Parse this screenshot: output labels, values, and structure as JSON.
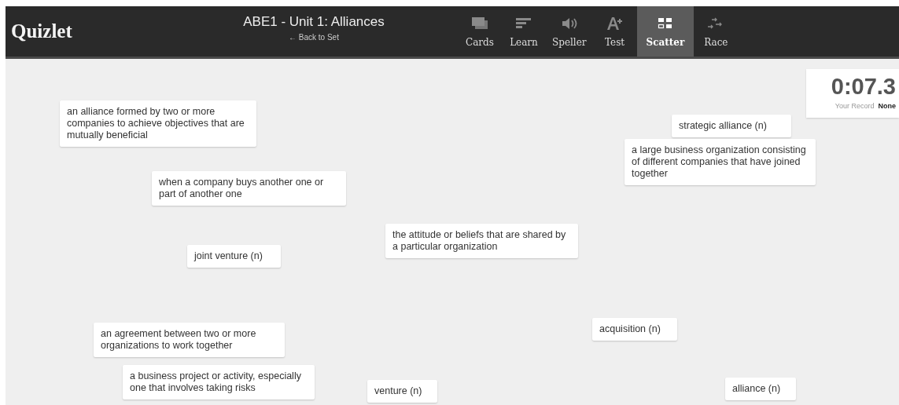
{
  "header": {
    "logo": "Quizlet",
    "title": "ABE1 - Unit 1: Alliances",
    "back_link": "← Back to Set"
  },
  "modes": [
    {
      "label": "Cards",
      "kind": "cards",
      "selected": false
    },
    {
      "label": "Learn",
      "kind": "learn",
      "selected": false
    },
    {
      "label": "Speller",
      "kind": "speller",
      "selected": false
    },
    {
      "label": "Test",
      "kind": "test",
      "selected": false
    },
    {
      "label": "Scatter",
      "kind": "scatter",
      "selected": true
    },
    {
      "label": "Race",
      "kind": "race",
      "selected": false
    }
  ],
  "timer": {
    "time": "0:07.3",
    "record_label": "Your Record",
    "record_value": "None"
  },
  "cards": [
    {
      "text": "an alliance formed by two or more companies to achieve objectives that are mutually beneficial"
    },
    {
      "text": "when a company buys another one or part of another one"
    },
    {
      "text": "joint venture (n)"
    },
    {
      "text": "the attitude or beliefs that are shared by a particular organization"
    },
    {
      "text": "strategic alliance (n)"
    },
    {
      "text": "a large business organization consisting of different companies that have joined together"
    },
    {
      "text": "an agreement between two or more organizations to work together"
    },
    {
      "text": "a business project or activity, especially one that involves taking risks"
    },
    {
      "text": "venture (n)"
    },
    {
      "text": "acquisition (n)"
    },
    {
      "text": "alliance (n)"
    }
  ]
}
